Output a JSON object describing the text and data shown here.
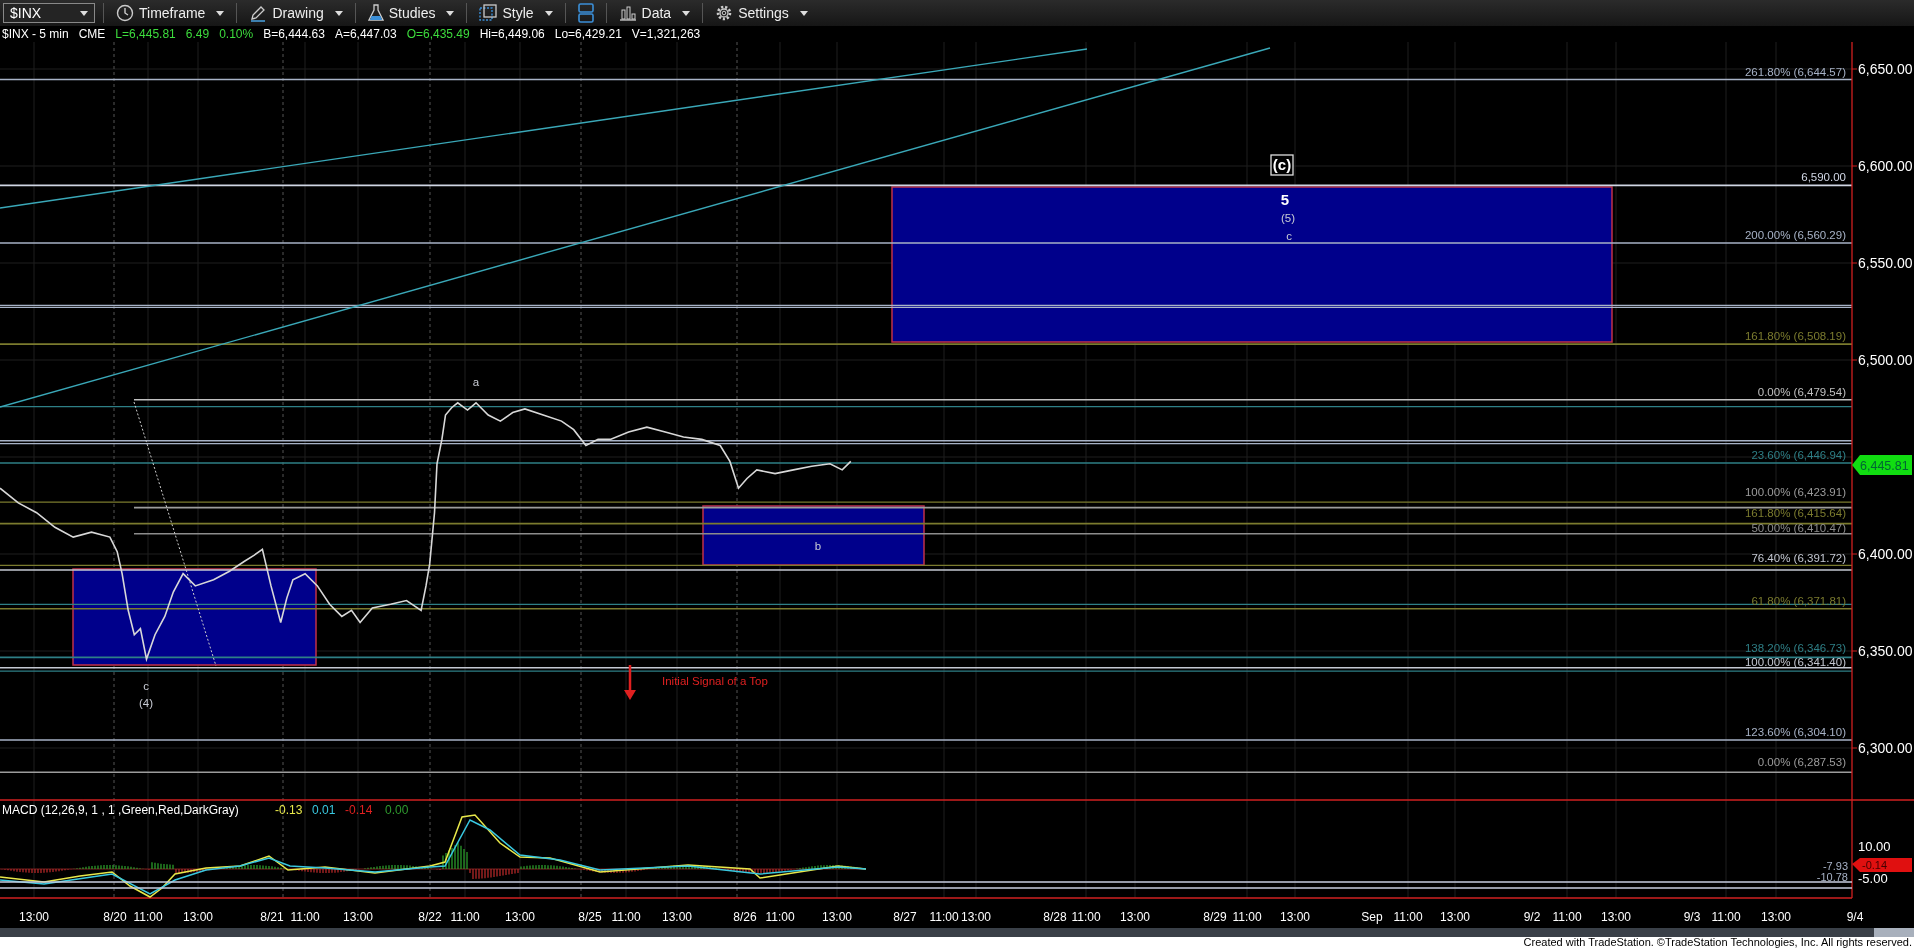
{
  "toolbar": {
    "symbol": "$INX",
    "buttons": [
      {
        "kind": "timeframe",
        "label": "Timeframe"
      },
      {
        "kind": "drawing",
        "label": "Drawing"
      },
      {
        "kind": "studies",
        "label": "Studies"
      },
      {
        "kind": "style",
        "label": "Style"
      },
      {
        "kind": "layout"
      },
      {
        "kind": "data",
        "label": "Data"
      },
      {
        "kind": "settings",
        "label": "Settings"
      }
    ]
  },
  "quote_line": [
    {
      "text": "$INX - 5 min",
      "color": "#ffffff"
    },
    {
      "text": "CME",
      "color": "#ffffff"
    },
    {
      "text": "L=6,445.81",
      "color": "#3ddc3d"
    },
    {
      "text": "6.49",
      "color": "#3ddc3d"
    },
    {
      "text": "0.10%",
      "color": "#3ddc3d"
    },
    {
      "text": "B=6,444.63",
      "color": "#ffffff"
    },
    {
      "text": "A=6,447.03",
      "color": "#ffffff"
    },
    {
      "text": "O=6,435.49",
      "color": "#3ddc3d"
    },
    {
      "text": "Hi=6,449.06",
      "color": "#ffffff"
    },
    {
      "text": "Lo=6,429.21",
      "color": "#ffffff"
    },
    {
      "text": "V=1,321,263",
      "color": "#ffffff"
    }
  ],
  "price_chart": {
    "fib_levels": [
      {
        "label": "261.80% (6,644.57)",
        "color": "#a7b2c6"
      },
      {
        "label": "6,590.00",
        "color": "#d0d6e4"
      },
      {
        "label": "200.00% (6,560.29)",
        "color": "#a7b2c6"
      },
      {
        "label": "161.80% (6,508.19)",
        "color": "#7b7b2e"
      },
      {
        "label": "0.00% (6,479.54)",
        "color": "#c0c0c0"
      },
      {
        "label": "23.60% (6,446.94)",
        "color": "#2e7f86"
      },
      {
        "label": "100.00% (6,423.91)",
        "color": "#9c9c9c"
      },
      {
        "label": "161.80% (6,415.64)",
        "color": "#7b7b2e"
      },
      {
        "label": "50.00% (6,410.47)",
        "color": "#8c8c8c"
      },
      {
        "label": "76.40% (6,391.72)",
        "color": "#c4c8d2"
      },
      {
        "label": "61.80% (6,371.81)",
        "color": "#7b7b2e"
      },
      {
        "label": "138.20% (6,346.73)",
        "color": "#2e7f86"
      },
      {
        "label": "100.00% (6,341.40)",
        "color": "#c4c8d2"
      },
      {
        "label": "123.60% (6,304.10)",
        "color": "#a7b2c6"
      },
      {
        "label": "0.00% (6,287.53)",
        "color": "#9c9c9c"
      }
    ],
    "wave_labels": [
      {
        "text": "(c)",
        "kind": "boxed"
      },
      {
        "text": "5",
        "kind": "bold"
      },
      {
        "text": "(5)",
        "kind": "plain"
      },
      {
        "text": "c",
        "kind": "plain"
      },
      {
        "text": "a",
        "kind": "plain"
      },
      {
        "text": "b",
        "kind": "plain"
      },
      {
        "text": "c",
        "kind": "plain"
      },
      {
        "text": "(4)",
        "kind": "plain"
      }
    ],
    "signal_note": "Initial Signal of a Top",
    "price_axis": [
      "6,650.00",
      "6,600.00",
      "6,550.00",
      "6,500.00",
      "6,400.00",
      "6,350.00",
      "6,300.00"
    ],
    "last_price": "6,445.81"
  },
  "macd": {
    "title": "MACD (12,26,9, 1 , 1 ,Green,Red,DarkGray)",
    "values": [
      {
        "text": "-0.13",
        "color": "#e8e84a"
      },
      {
        "text": "0.01",
        "color": "#39c8e0"
      },
      {
        "text": "-0.14",
        "color": "#e02020"
      },
      {
        "text": "0.00",
        "color": "#2e9a2e"
      }
    ],
    "axis": [
      "10.00",
      "-5.00"
    ],
    "line_labels": [
      "-7.93",
      "-10.78"
    ],
    "last_value": "-0.14"
  },
  "time_axis": [
    "13:00",
    "8/20",
    "11:00",
    "13:00",
    "8/21",
    "11:00",
    "13:00",
    "8/22",
    "11:00",
    "13:00",
    "8/25",
    "11:00",
    "13:00",
    "8/26",
    "11:00",
    "13:00",
    "8/27",
    "11:00",
    "13:00",
    "8/28",
    "11:00",
    "13:00",
    "8/29",
    "11:00",
    "13:00",
    "Sep",
    "11:00",
    "13:00",
    "9/2",
    "11:00",
    "13:00",
    "9/3",
    "11:00",
    "13:00",
    "9/4"
  ],
  "footer": "Created with TradeStation. ©TradeStation Technologies, Inc. All rights reserved."
}
